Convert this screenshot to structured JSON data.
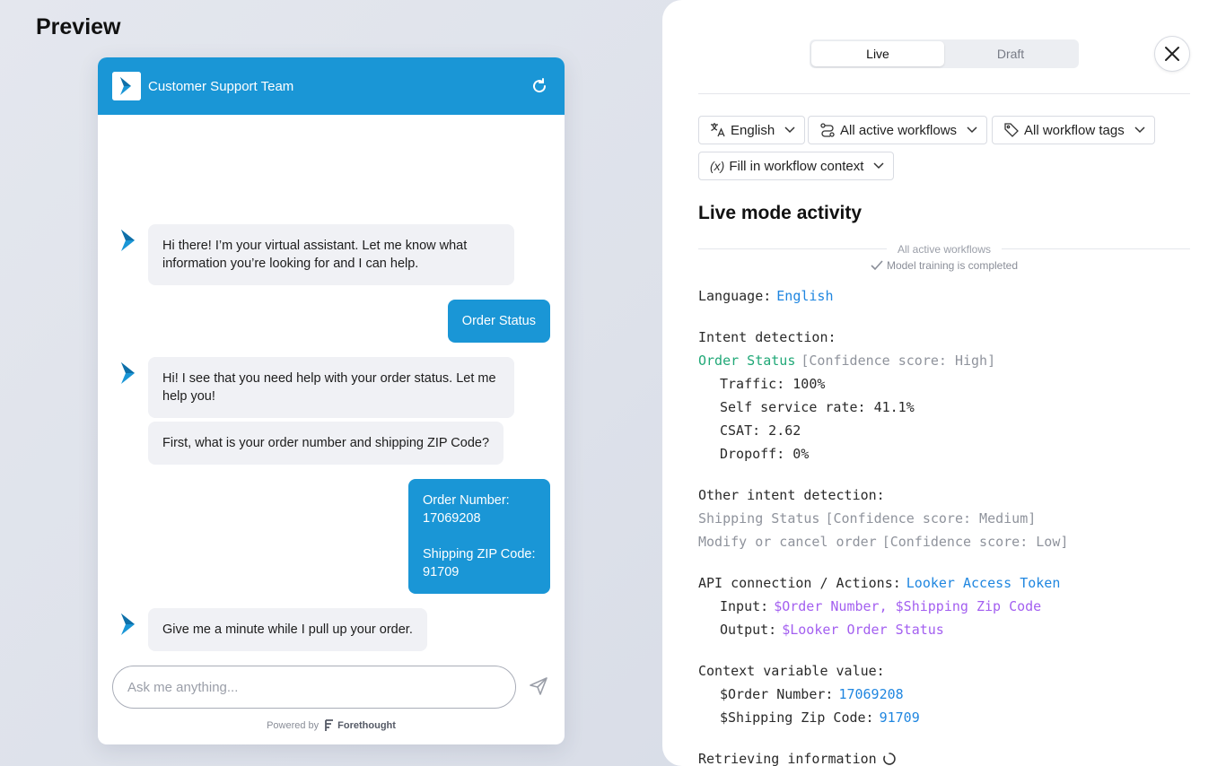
{
  "page_title": "Preview",
  "widget": {
    "team_name": "Customer Support Team",
    "messages": [
      {
        "from": "bot",
        "text": "Hi there! I’m your virtual assistant. Let me know what information you’re looking for and I can help."
      },
      {
        "from": "user",
        "text": "Order Status"
      },
      {
        "from": "bot",
        "text": "Hi! I see that you need help with your order status. Let me help you!"
      },
      {
        "from": "bot",
        "text": "First, what is your order number and shipping ZIP Code?"
      },
      {
        "from": "user",
        "lines": [
          "Order Number:",
          "17069208",
          "",
          "Shipping ZIP Code:",
          "91709"
        ]
      },
      {
        "from": "bot",
        "text": "Give me a minute while I pull up your order."
      }
    ],
    "input_placeholder": "Ask me anything...",
    "powered_by": "Powered by",
    "brand": "Forethought",
    "accent_color": "#1a96d6"
  },
  "panel": {
    "tabs": [
      "Live",
      "Draft"
    ],
    "active_tab": "Live",
    "filters": {
      "language": "English",
      "workflows": "All active workflows",
      "tags": "All workflow tags",
      "context": "Fill in workflow context"
    },
    "activity_title": "Live mode activity",
    "divider_label": "All active workflows",
    "training_status": "Model training is completed",
    "language_label": "Language:",
    "language_value": "English",
    "intent_label": "Intent detection:",
    "intent_name": "Order Status",
    "intent_confidence": "[Confidence score: High]",
    "metrics": [
      "Traffic: 100%",
      "Self service rate: 41.1%",
      "CSAT: 2.62",
      "Dropoff: 0%"
    ],
    "other_intent_label": "Other intent detection:",
    "other_intents": [
      {
        "name": "Shipping Status",
        "confidence": "[Confidence score: Medium]"
      },
      {
        "name": "Modify or cancel order",
        "confidence": "[Confidence score: Low]"
      }
    ],
    "api_label": "API connection / Actions:",
    "api_value": "Looker Access Token",
    "input_label": "Input:",
    "input_value": "$Order Number, $Shipping Zip Code",
    "output_label": "Output:",
    "output_value": "$Looker Order Status",
    "context_label": "Context variable value:",
    "context_vars": [
      {
        "name": "$Order Number:",
        "value": "17069208"
      },
      {
        "name": "$Shipping Zip Code:",
        "value": "91709"
      }
    ],
    "retrieving": "Retrieving information"
  }
}
